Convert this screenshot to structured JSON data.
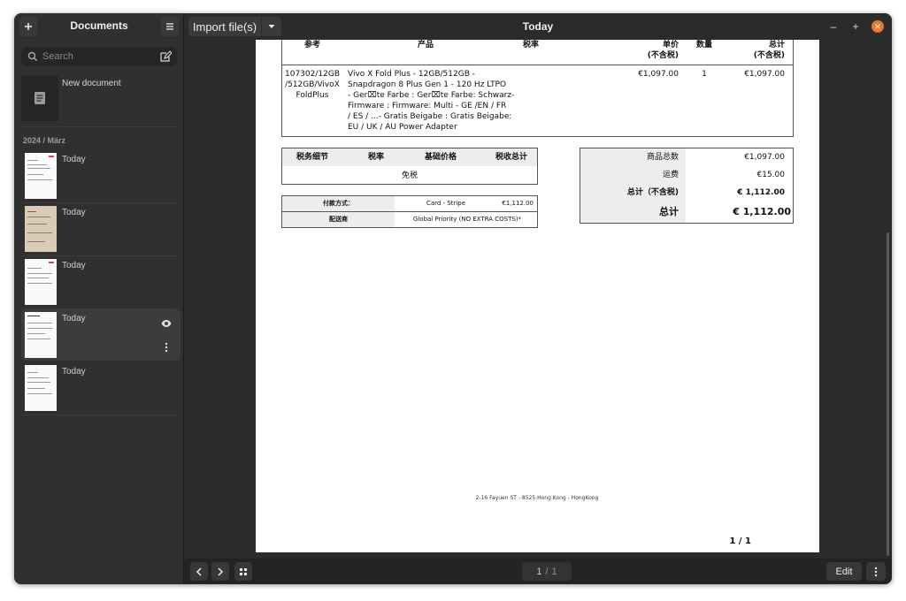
{
  "sidebar": {
    "title": "Documents",
    "add_icon": "plus-icon",
    "menu_icon": "hamburger-icon",
    "search_placeholder": "Search",
    "new_document_label": "New document",
    "group_label": "2024 / März",
    "documents": [
      {
        "date": "Today"
      },
      {
        "date": "Today"
      },
      {
        "date": "Today"
      },
      {
        "date": "Today"
      },
      {
        "date": "Today"
      }
    ]
  },
  "header": {
    "import_label": "Import file(s)",
    "title": "Today",
    "minimize": "–",
    "maximize": "+",
    "close": "×"
  },
  "invoice": {
    "columns": {
      "ref": "参考",
      "product": "产品",
      "tax_rate": "税率",
      "unit_price": "单价",
      "unit_price_sub": "(不含税)",
      "qty": "数量",
      "total": "总计",
      "total_sub": "(不含税)"
    },
    "line": {
      "ref": "107302/12GB/512GB/VivoXFoldPlus",
      "ref_lines": [
        "107302/12GB",
        "/512GB/VivoX",
        "FoldPlus"
      ],
      "product_lines": [
        "Vivo X Fold Plus - 12GB/512GB -",
        "Snapdragon 8 Plus Gen 1 - 120 Hz LTPO",
        "- Ger⌧te Farbe : Ger⌧te Farbe: Schwarz-",
        "Firmware : Firmware: Multi - GE /EN / FR",
        "/ ES / ...- Gratis Beigabe : Gratis Beigabe:",
        "EU / UK / AU Power Adapter"
      ],
      "unit_price": "€1,097.00",
      "qty": "1",
      "total": "€1,097.00"
    },
    "tax_table": {
      "headers": [
        "税务细节",
        "税率",
        "基础价格",
        "税收总计"
      ],
      "value": "免税"
    },
    "payment": {
      "method_label": "付款方式：",
      "method_value": "Card - Stripe",
      "method_amount": "€1,112.00",
      "carrier_label": "配送商",
      "carrier_value": "Global Priority (NO EXTRA COSTS)*"
    },
    "totals": {
      "items_label": "商品总数",
      "items_value": "€1,097.00",
      "shipping_label": "运费",
      "shipping_value": "€15.00",
      "subtotal_label": "总计（不含税)",
      "subtotal_value": "€ 1,112.00",
      "total_label": "总计",
      "total_value": "€ 1,112.00"
    },
    "address": "2-16 Fayuen ST - 8525 Hong Kong - HongKong",
    "page_number": "1 / 1"
  },
  "footer": {
    "current_page": "1",
    "page_separator": "/",
    "total_pages": "1",
    "edit_label": "Edit"
  }
}
